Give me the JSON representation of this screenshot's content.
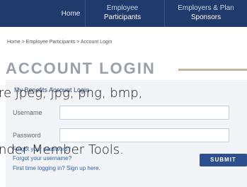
{
  "nav": {
    "home": "Home",
    "employee_line1": "Employee",
    "employee_line2": "Participants",
    "sponsors_line1": "Employers & Plan",
    "sponsors_line2": "Sponsors"
  },
  "breadcrumb": "Home > Employee Participants > Account Login",
  "page_title": "ACCOUNT LOGIN",
  "panel": {
    "heading": "My Benefits Account Login",
    "username_label": "Username",
    "password_label": "Password",
    "username_value": "",
    "password_value": "",
    "submit_label": "SUBMIT",
    "links": [
      "Forgot your password?",
      "Forgot your username?",
      "First time logging in? Sign up here."
    ]
  },
  "overlay": {
    "line1": "re jpeg, jpg, png, bmp,",
    "line2": "nder Member Tools."
  },
  "colors": {
    "nav_bg": "#1f3a6b",
    "link": "#2d5fb3",
    "submit_bg": "#2d4f8f"
  }
}
